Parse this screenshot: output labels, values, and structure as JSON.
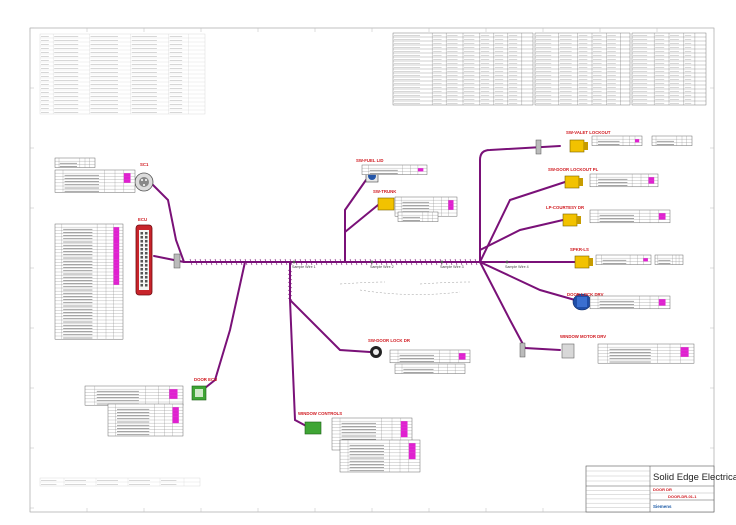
{
  "title_block": {
    "brand": "Solid Edge Electrical",
    "doc_label": "DOOR DR",
    "doc_number": "DOOR-DR-01-1",
    "company": "Siemens"
  },
  "connectors": [
    {
      "id": "sc1",
      "label": "SC1"
    },
    {
      "id": "ecu",
      "label": "ECU"
    },
    {
      "id": "fuel",
      "label": "SW-FUEL LID"
    },
    {
      "id": "trunk",
      "label": "SW-TRUNK"
    },
    {
      "id": "valet",
      "label": "SW-VALET LOCKOUT"
    },
    {
      "id": "doorlockpl",
      "label": "SW-DOOR LOCKOUT PL"
    },
    {
      "id": "courtesy",
      "label": "LP-COURTESY DR"
    },
    {
      "id": "spkr",
      "label": "SPKR-LS"
    },
    {
      "id": "doorlockdrv",
      "label": "DOOR LOCK DRV"
    },
    {
      "id": "window",
      "label": "WINDOW MOTOR DRV"
    },
    {
      "id": "doorlockdr",
      "label": "SW-DOOR LOCK DR"
    },
    {
      "id": "doorecu",
      "label": "DOOR ECU"
    },
    {
      "id": "windowctl",
      "label": "WINDOW CONTROLS"
    }
  ],
  "splices": [
    "Sample Wire 1",
    "Sample Wire 2",
    "Sample Wire 3",
    "Sample Wire 4"
  ]
}
